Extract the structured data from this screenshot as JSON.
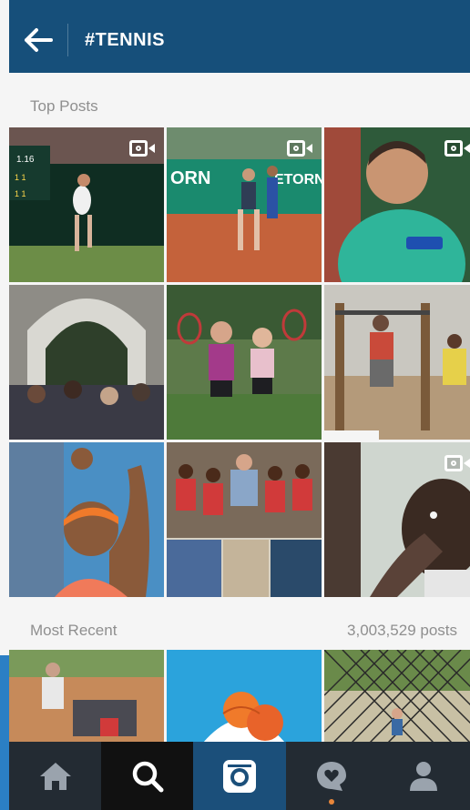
{
  "header": {
    "title": "#TENNIS"
  },
  "sections": {
    "top_posts": "Top Posts",
    "most_recent": "Most Recent",
    "post_count": "3,003,529 posts"
  },
  "top_posts": [
    {
      "name": "grass-court-player",
      "video": true
    },
    {
      "name": "clay-court-player",
      "video": true
    },
    {
      "name": "player-closeup-green",
      "video": true
    },
    {
      "name": "crowd-under-arch",
      "video": false
    },
    {
      "name": "two-players-rackets",
      "video": false
    },
    {
      "name": "outdoor-pullup-bar",
      "video": false
    },
    {
      "name": "player-arm-raised",
      "video": false
    },
    {
      "name": "kids-group-collage",
      "video": false
    },
    {
      "name": "selfie-closeup",
      "video": true
    }
  ],
  "recent_posts": [
    {
      "name": "recent-clay-court"
    },
    {
      "name": "recent-racket-illustration"
    },
    {
      "name": "recent-fence-court"
    }
  ],
  "tabs": [
    "home",
    "explore",
    "camera",
    "activity",
    "profile"
  ],
  "colors": {
    "header": "#164f7a",
    "bottom_bar": "#232b33",
    "activity_dot": "#e8863a"
  }
}
